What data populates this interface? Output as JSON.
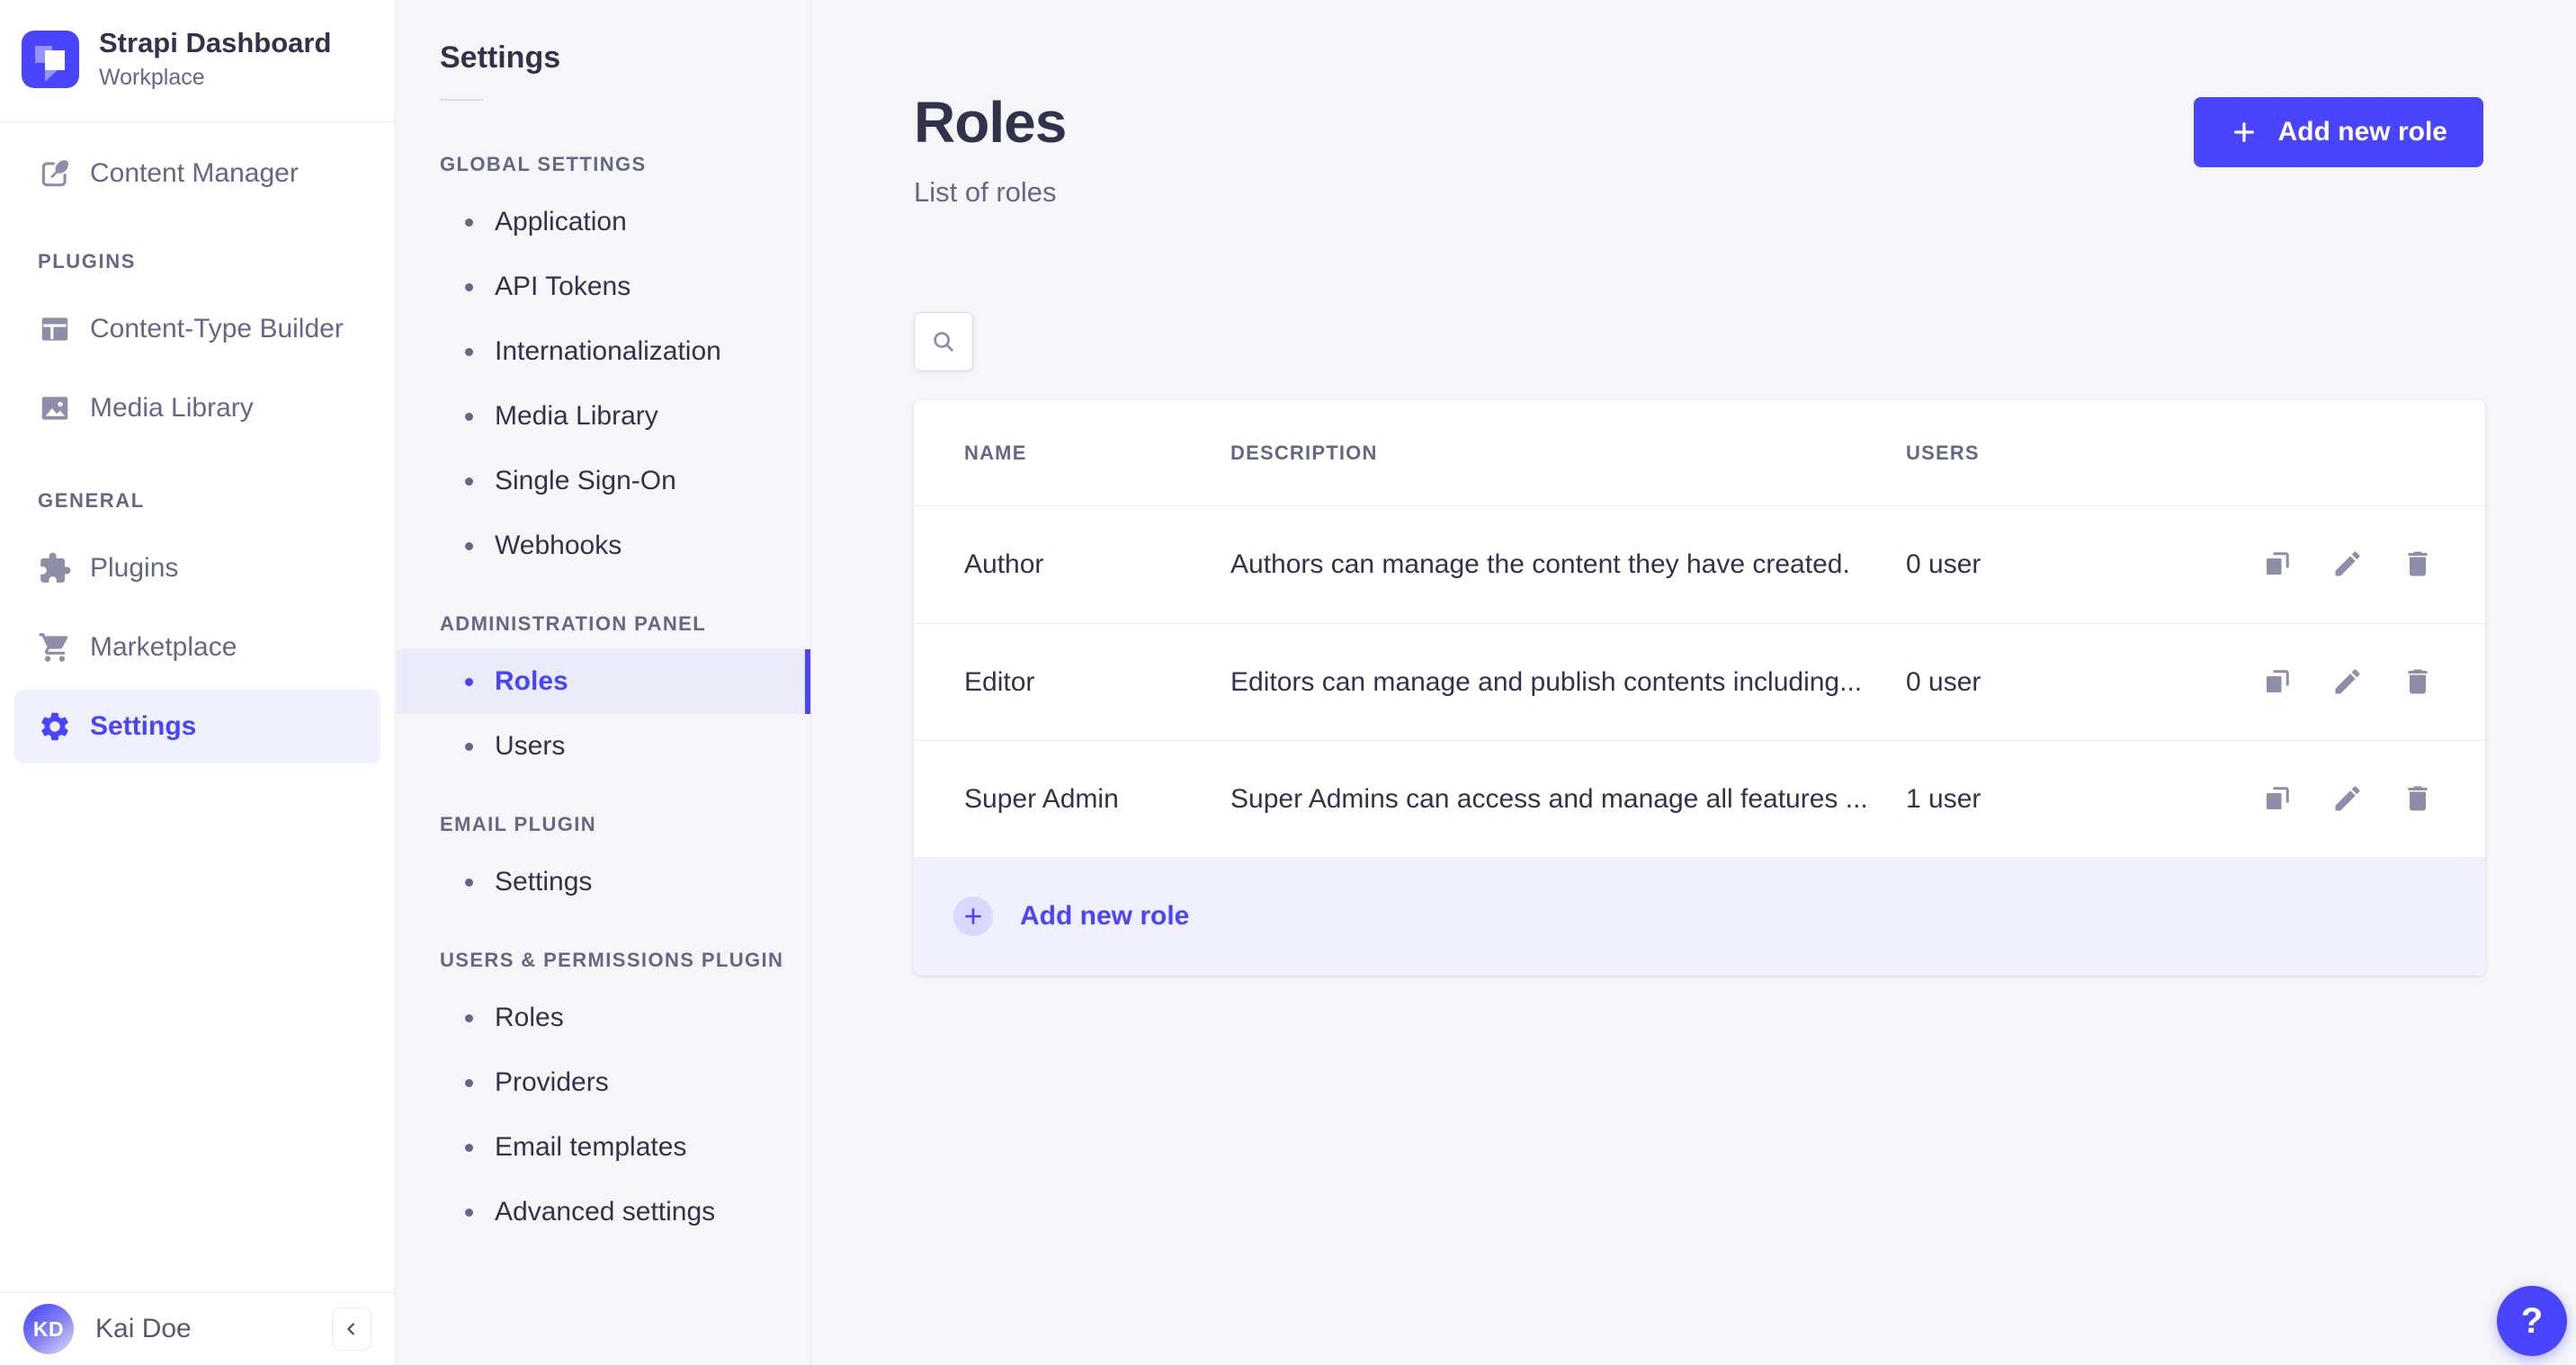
{
  "app": {
    "name": "Strapi Dashboard"
  },
  "colors": {
    "brand": "#4945ff",
    "brand_light": "#f0f0ff",
    "background": "#f6f6f9",
    "surface": "#ffffff",
    "border": "#eaeaef",
    "text": "#32324d",
    "text_muted": "#666687",
    "icon": "#8e8ea9",
    "active_band": "#ebebfa",
    "plus_circle_bg": "#d9d8ff"
  },
  "icons": {
    "plus": "+",
    "help": "?",
    "collapse": "‹",
    "search": "magnifier",
    "duplicate": "copy-squares",
    "edit": "pencil",
    "delete": "trash"
  },
  "sidebar": {
    "brand": {
      "title": "Strapi Dashboard",
      "subtitle": "Workplace"
    },
    "content_manager": {
      "label": "Content Manager"
    },
    "sections": [
      {
        "label": "PLUGINS",
        "items": [
          {
            "label": "Content-Type Builder"
          },
          {
            "label": "Media Library"
          }
        ]
      },
      {
        "label": "GENERAL",
        "items": [
          {
            "label": "Plugins"
          },
          {
            "label": "Marketplace"
          },
          {
            "label": "Settings",
            "active": true
          }
        ]
      }
    ],
    "user": {
      "initials": "KD",
      "name": "Kai Doe"
    }
  },
  "subnav": {
    "title": "Settings",
    "groups": [
      {
        "label": "GLOBAL SETTINGS",
        "items": [
          {
            "label": "Application"
          },
          {
            "label": "API Tokens"
          },
          {
            "label": "Internationalization"
          },
          {
            "label": "Media Library"
          },
          {
            "label": "Single Sign-On"
          },
          {
            "label": "Webhooks"
          }
        ]
      },
      {
        "label": "ADMINISTRATION PANEL",
        "items": [
          {
            "label": "Roles",
            "active": true
          },
          {
            "label": "Users"
          }
        ]
      },
      {
        "label": "EMAIL PLUGIN",
        "items": [
          {
            "label": "Settings"
          }
        ]
      },
      {
        "label": "USERS & PERMISSIONS PLUGIN",
        "items": [
          {
            "label": "Roles"
          },
          {
            "label": "Providers"
          },
          {
            "label": "Email templates"
          },
          {
            "label": "Advanced settings"
          }
        ]
      }
    ]
  },
  "main": {
    "title": "Roles",
    "subtitle": "List of roles",
    "add_button_label": "Add new role",
    "table": {
      "columns": [
        "NAME",
        "DESCRIPTION",
        "USERS"
      ],
      "rows": [
        {
          "name": "Author",
          "description": "Authors can manage the content they have created.",
          "users": "0 user"
        },
        {
          "name": "Editor",
          "description": "Editors can manage and publish contents including...",
          "users": "0 user"
        },
        {
          "name": "Super Admin",
          "description": "Super Admins can access and manage all features ...",
          "users": "1 user"
        }
      ],
      "footer_add_label": "Add new role"
    },
    "help_label": "?"
  }
}
